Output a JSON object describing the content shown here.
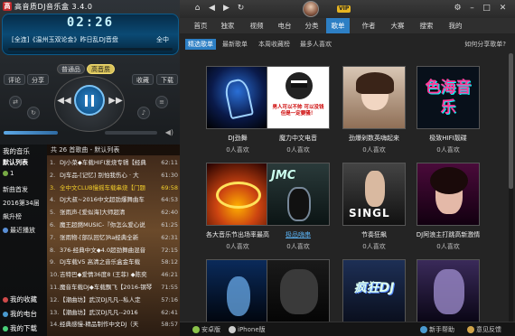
{
  "app": {
    "title": "高音质DJ音乐盒 3.4.0",
    "logo": "高"
  },
  "player": {
    "time": "02:26",
    "track": "[全连]《温州玉双论金》昨日乱DJ音盘",
    "mode": "全中",
    "quality": {
      "normal": "普通品",
      "high": "高音质"
    },
    "buttons": {
      "lyrics": "评论",
      "share": "分享",
      "collect": "收藏",
      "download": "下载"
    },
    "icons": [
      "prev-icon",
      "play-pause-icon",
      "next-icon",
      "volume-icon"
    ]
  },
  "library": {
    "header": "我的音乐",
    "items": [
      {
        "label": "默认列表",
        "type": "active"
      },
      {
        "label": "1",
        "type": "normal"
      },
      {
        "label": "新曲首发",
        "type": "normal"
      },
      {
        "label": "2016第34届",
        "type": "normal"
      },
      {
        "label": "飙升榜",
        "type": "normal"
      },
      {
        "label": "最近播放",
        "type": "normal"
      },
      {
        "label": "我的收藏",
        "type": "section"
      },
      {
        "label": "我的电台",
        "type": "section"
      },
      {
        "label": "我的下载",
        "type": "section"
      }
    ]
  },
  "playlist": {
    "header": "共 26 首歌曲 - 默认列表",
    "rows": [
      {
        "num": "1.",
        "title": "DJ小菜◆车载HIFI发烧专辑【经典",
        "time": "62:11"
      },
      {
        "num": "2.",
        "title": "DJ车品-[记忆] 别怕我伤心 · 大",
        "time": "61:30"
      },
      {
        "num": "3.",
        "title": "全中文CLUB慢摇车载串烧【门题",
        "time": "69:58"
      },
      {
        "num": "4.",
        "title": "DJ大叔~2016中文超劲爆舞曲车",
        "time": "64:53"
      },
      {
        "num": "5.",
        "title": "张雨声-[爱似海]大师超清",
        "time": "62:40"
      },
      {
        "num": "6.",
        "title": "魔王超燃MUSIC-『你怎么爱心说",
        "time": "61:25"
      },
      {
        "num": "7.",
        "title": "张雨物-[部队回忆]Ra经典全新",
        "time": "62:31"
      },
      {
        "num": "8.",
        "title": "376-经典中文◆4.0超劲舞曲混音",
        "time": "72:15"
      },
      {
        "num": "9.",
        "title": "DJ车载V5 高清之音乐盒金车载",
        "time": "58:12"
      },
      {
        "num": "10.",
        "title": "吉特巴◆爱情36度8 (王菲) ◆陈奕",
        "time": "46:21"
      },
      {
        "num": "11.",
        "title": "魔音车载DJ◆车载飘飞【2016-钢琴",
        "time": "71:55"
      },
      {
        "num": "12.",
        "title": "【潮曲坊】武汉DJ凡凡--私人定",
        "time": "57:16"
      },
      {
        "num": "13.",
        "title": "【潮曲坊】武汉DJ凡凡--2016",
        "time": "62:41"
      },
      {
        "num": "14.",
        "title": "经典感慢-精品制作中文DJ（天",
        "time": "58:57"
      }
    ],
    "current_index": 2
  },
  "topbar": {
    "vip": "VIP",
    "icons": [
      "home-icon",
      "back-icon",
      "forward-icon",
      "refresh-icon",
      "settings-icon",
      "minimize-icon",
      "maximize-icon",
      "close-icon"
    ]
  },
  "nav": {
    "tabs": [
      "首页",
      "独家",
      "视频",
      "电台",
      "分类",
      "歌单",
      "作者",
      "大赛",
      "搜索",
      "我的"
    ],
    "active_index": 5
  },
  "subtabs": {
    "tabs": [
      "精选歌单",
      "最新歌单",
      "本周收藏榜",
      "最多人喜欢"
    ],
    "active_index": 0,
    "share_link": "如何分享歌单?"
  },
  "cards": [
    {
      "title": "DJ劲舞",
      "likes": "0人喜欢",
      "link": false,
      "cover": "cover-dance"
    },
    {
      "title": "魔力中文电音",
      "likes": "0人喜欢",
      "link": false,
      "cover": "cover-meme"
    },
    {
      "title": "劲爆剁数英嗨起来",
      "likes": "0人喜欢",
      "link": false,
      "cover": "cover-girl"
    },
    {
      "title": "极致HIFI靓碟",
      "likes": "0人喜欢",
      "link": false,
      "cover": "cover-sehai"
    },
    {
      "title": "各大音乐节出场率最高",
      "likes": "0人喜欢",
      "link": false,
      "cover": "cover-festival"
    },
    {
      "title": "极品嗨串",
      "likes": "0人喜欢",
      "link": true,
      "cover": "cover-jmc"
    },
    {
      "title": "节奏狂飙",
      "likes": "0人喜欢",
      "link": false,
      "cover": "cover-single"
    },
    {
      "title": "DJ阿浪主打跳高新激情",
      "likes": "0人喜欢",
      "link": false,
      "cover": "cover-singer"
    },
    {
      "title": "",
      "likes": "",
      "link": false,
      "cover": "cover-blue"
    },
    {
      "title": "",
      "likes": "",
      "link": false,
      "cover": "cover-dark"
    },
    {
      "title": "",
      "likes": "",
      "link": false,
      "cover": "cover-fengkuang"
    },
    {
      "title": "",
      "likes": "",
      "link": false,
      "cover": "cover-purple"
    }
  ],
  "cover_text": {
    "meme": "男人可以不帅 可以没钱 但是一定要骚！",
    "sehai": "色海音乐",
    "jmc": "JMC",
    "single": "SINGL",
    "fengkuang": "疯狂DJ"
  },
  "bottom": {
    "android": "安卓版",
    "iphone": "iPhone版",
    "help": "新手帮助",
    "feedback": "意见反馈"
  },
  "colors": {
    "accent": "#2d7fc4",
    "current_track": "#f4cf2a",
    "vip": "#e6b422"
  }
}
